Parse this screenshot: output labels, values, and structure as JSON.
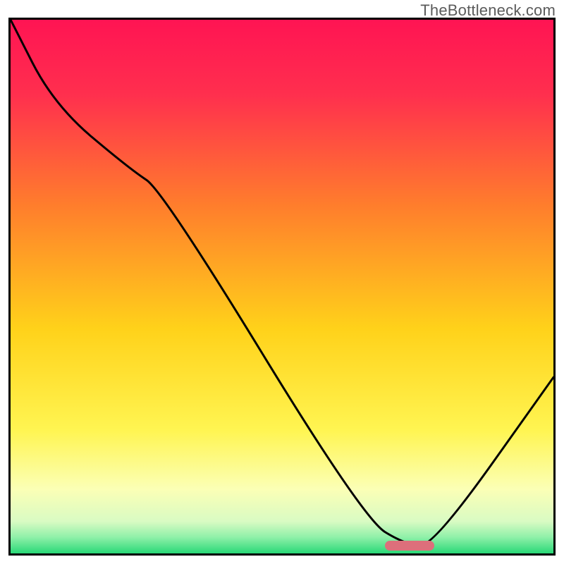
{
  "watermark": "TheBottleneck.com",
  "chart_data": {
    "type": "line",
    "title": "",
    "xlabel": "",
    "ylabel": "",
    "xlim": [
      0,
      100
    ],
    "ylim": [
      0,
      100
    ],
    "series": [
      {
        "name": "bottleneck-curve",
        "x": [
          0,
          8,
          22,
          28,
          65,
          73,
          78,
          100
        ],
        "values": [
          100,
          84,
          72,
          68,
          6.5,
          1.5,
          1.5,
          33
        ]
      }
    ],
    "marker": {
      "x_start": 69,
      "x_end": 78,
      "y": 1.5
    },
    "gradient_stops": [
      {
        "pct": 0,
        "color": "#ff1453"
      },
      {
        "pct": 14,
        "color": "#ff2f4e"
      },
      {
        "pct": 35,
        "color": "#ff7e2c"
      },
      {
        "pct": 58,
        "color": "#ffd21a"
      },
      {
        "pct": 77,
        "color": "#fff552"
      },
      {
        "pct": 88,
        "color": "#fbffb6"
      },
      {
        "pct": 94,
        "color": "#d9fbc3"
      },
      {
        "pct": 97,
        "color": "#8ef0a8"
      },
      {
        "pct": 100,
        "color": "#29d877"
      }
    ]
  }
}
